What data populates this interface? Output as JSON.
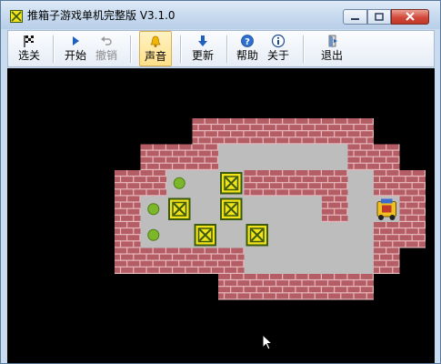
{
  "window": {
    "title": "推箱子游戏单机完整版 V3.1.0",
    "title_icon": "sokoban-box-icon"
  },
  "toolbar": {
    "buttons": [
      {
        "label": "选关",
        "icon": "checkered-flag-icon",
        "enabled": true,
        "active": false
      },
      {
        "label": "开始",
        "icon": "play-icon",
        "enabled": true,
        "active": false
      },
      {
        "label": "撤销",
        "icon": "undo-icon",
        "enabled": false,
        "active": false
      },
      {
        "label": "声音",
        "icon": "bell-icon",
        "enabled": true,
        "active": true
      },
      {
        "label": "更新",
        "icon": "download-arrow-icon",
        "enabled": true,
        "active": false
      },
      {
        "label": "帮助",
        "icon": "help-icon",
        "enabled": true,
        "active": false
      },
      {
        "label": "关于",
        "icon": "info-icon",
        "enabled": true,
        "active": false
      },
      {
        "label": "退出",
        "icon": "exit-door-icon",
        "enabled": true,
        "active": false
      }
    ]
  },
  "board": {
    "legend": {
      "#": "wall",
      ".": "floor",
      "g": "goal",
      "B": "box",
      "P": "player",
      " ": "void"
    },
    "rows": [
      "   #######  ",
      " ###.....## ",
      "##g.B####.##",
      "#gB.B...#.P#",
      "#g.B.B....##",
      "#####.....# ",
      "    ###### "
    ],
    "colors": {
      "wall": "#b55d65",
      "wall_mortar": "#e7b9bd",
      "floor": "#bdbdbd",
      "goal": "#7cb62a",
      "box_fill": "#f2e21c",
      "box_frame": "#3c5a0c",
      "background": "#000000"
    }
  }
}
